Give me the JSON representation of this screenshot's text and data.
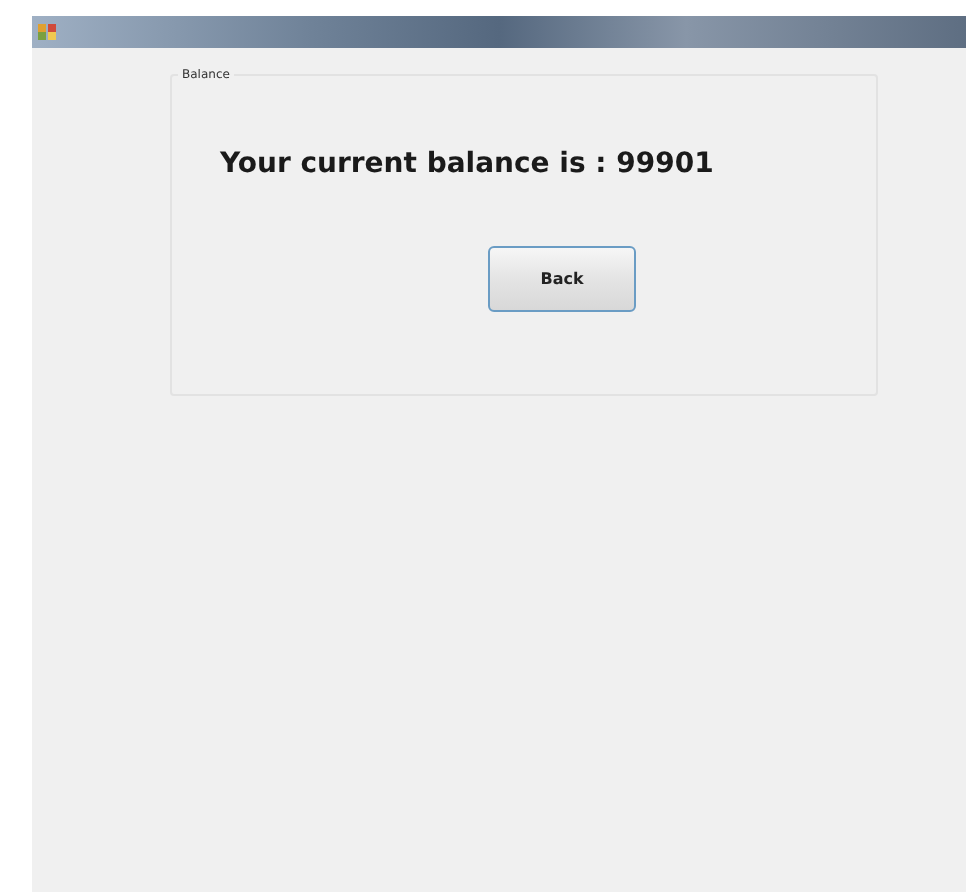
{
  "group": {
    "title": "Balance"
  },
  "message": "Your current balance is : 99901",
  "buttons": [
    {
      "label": "Back"
    }
  ]
}
